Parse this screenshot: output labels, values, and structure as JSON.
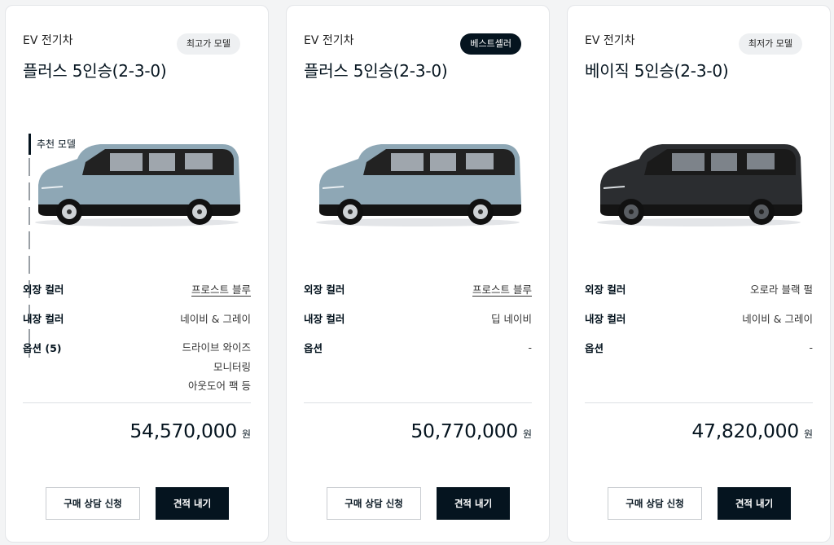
{
  "cards": [
    {
      "category": "EV 전기차",
      "model": "플러스 5인승(2-3-0)",
      "badge": "최고가 모델",
      "recommended_label": "추천 모델",
      "specs": {
        "exterior_label": "외장 컬러",
        "exterior_value": "프로스트 블루",
        "interior_label": "내장 컬러",
        "interior_value": "네이비 & 그레이",
        "options_label": "옵션 (5)",
        "options_lines": [
          "드라이브 와이즈",
          "모니터링",
          "아웃도어 팩 등"
        ]
      },
      "price": "54,570,000",
      "currency": "원",
      "consult_button": "구매 상담 신청",
      "quote_button": "견적 내기",
      "car_color": "#8ea7b5"
    },
    {
      "category": "EV 전기차",
      "model": "플러스 5인승(2-3-0)",
      "badge": "베스트셀러",
      "specs": {
        "exterior_label": "외장 컬러",
        "exterior_value": "프로스트 블루",
        "interior_label": "내장 컬러",
        "interior_value": "딥 네이비",
        "options_label": "옵션",
        "options_value": "-"
      },
      "price": "50,770,000",
      "currency": "원",
      "consult_button": "구매 상담 신청",
      "quote_button": "견적 내기",
      "car_color": "#8ea7b5"
    },
    {
      "category": "EV 전기차",
      "model": "베이직 5인승(2-3-0)",
      "badge": "최저가 모델",
      "specs": {
        "exterior_label": "외장 컬러",
        "exterior_value": "오로라 블랙 펄",
        "interior_label": "내장 컬러",
        "interior_value": "네이비 & 그레이",
        "options_label": "옵션",
        "options_value": "-"
      },
      "price": "47,820,000",
      "currency": "원",
      "consult_button": "구매 상담 신청",
      "quote_button": "견적 내기",
      "car_color": "#2b2d30"
    }
  ],
  "colors": {
    "brand_dark": "#05141f",
    "badge_light": "#eef0f2",
    "card_bg": "#ffffff",
    "page_bg": "#f3f4f5"
  }
}
